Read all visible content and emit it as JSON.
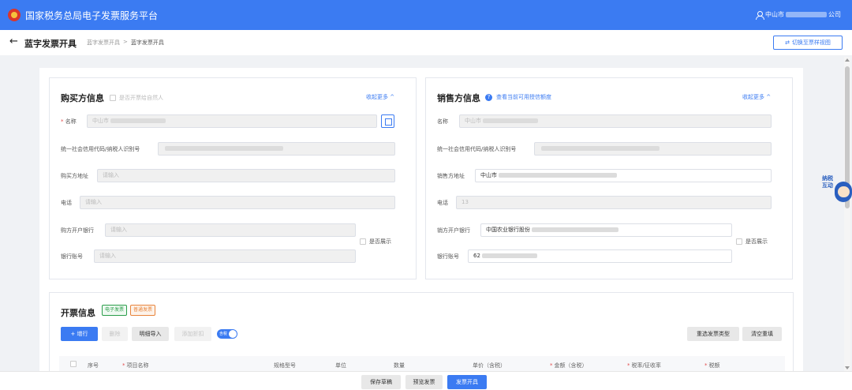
{
  "app": {
    "title": "国家税务总局电子发票服务平台",
    "user_label": "中山市",
    "user_suffix": "公司"
  },
  "header": {
    "back": "←",
    "title": "蓝字发票开具",
    "breadcrumb": [
      "蓝字发票开具",
      ">",
      "蓝字发票开具"
    ],
    "switch_button": "切换至票样视图",
    "switch_icon": "swap-icon"
  },
  "buyer": {
    "title": "购买方信息",
    "natural_person": "是否开票给自然人",
    "collapse": "收起更多 ^",
    "fields": {
      "name": {
        "label": "名称",
        "value": "中山市"
      },
      "tax_id": {
        "label": "统一社会信用代码/纳税人识别号",
        "value": ""
      },
      "address": {
        "label": "购买方地址",
        "placeholder": "请输入"
      },
      "phone": {
        "label": "电话",
        "placeholder": "请输入"
      },
      "bank": {
        "label": "购方开户银行",
        "placeholder": "请输入"
      },
      "account": {
        "label": "银行账号",
        "placeholder": "请输入"
      }
    },
    "show_label": "是否展示"
  },
  "seller": {
    "title": "销售方信息",
    "quota_link": "查看当前可用授信额度",
    "collapse": "收起更多 ^",
    "fields": {
      "name": {
        "label": "名称",
        "value": "中山市"
      },
      "tax_id": {
        "label": "统一社会信用代码/纳税人识别号",
        "value": ""
      },
      "address": {
        "label": "销售方地址",
        "value": "中山市"
      },
      "phone": {
        "label": "电话",
        "value": "13"
      },
      "bank": {
        "label": "销方开户银行",
        "value": "中国农业银行股份"
      },
      "account": {
        "label": "银行账号",
        "value": "62"
      }
    },
    "show_label": "是否展示"
  },
  "invoice": {
    "title": "开票信息",
    "tags": [
      "电子发票",
      "普通发票"
    ],
    "buttons": {
      "add": "+ 增行",
      "delete": "删除",
      "import": "明细导入",
      "discount": "添加折扣",
      "tax_toggle": "含税",
      "reselect": "重选发票类型",
      "clear": "清空重填"
    },
    "columns": [
      {
        "label": "序号",
        "required": false
      },
      {
        "label": "项目名称",
        "required": true
      },
      {
        "label": "规格型号",
        "required": false
      },
      {
        "label": "单位",
        "required": false
      },
      {
        "label": "数量",
        "required": false
      },
      {
        "label": "单价（含税）",
        "required": false
      },
      {
        "label": "金额（含税）",
        "required": true
      },
      {
        "label": "税率/征收率",
        "required": true
      },
      {
        "label": "税额",
        "required": true
      }
    ]
  },
  "robot": {
    "text": "纳税互动"
  },
  "footer": {
    "save": "保存草稿",
    "preview": "预览发票",
    "issue": "发票开具"
  },
  "colors": {
    "primary": "#3b7bf2",
    "required": "#e34d4d",
    "tag_green": "#2a9d4a",
    "tag_orange": "#e8833a"
  }
}
